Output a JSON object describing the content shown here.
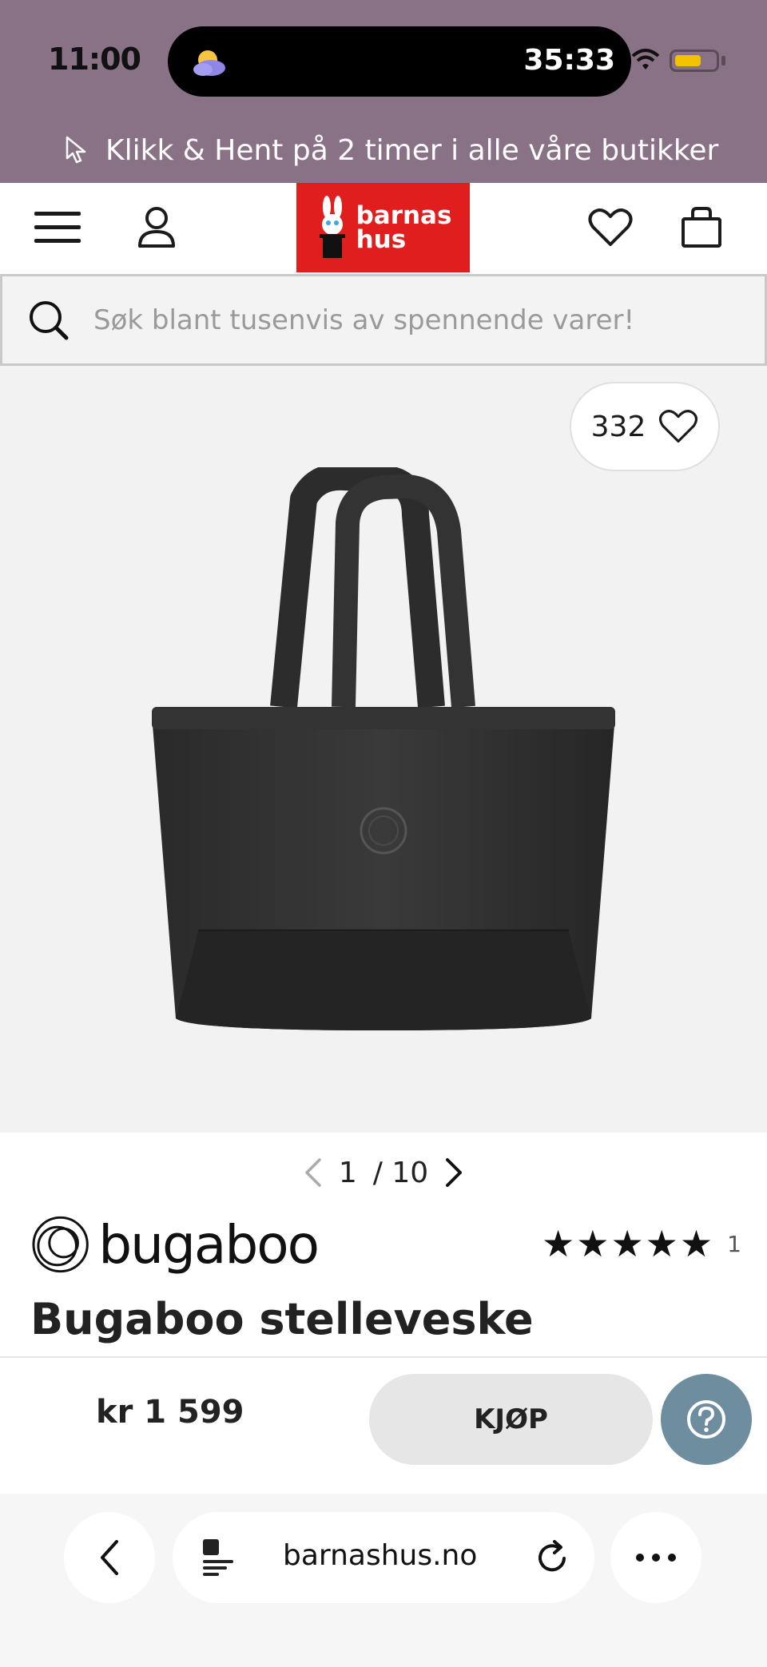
{
  "status_bar": {
    "time": "11:00",
    "timer": "35:33"
  },
  "promo": {
    "text": "Klikk & Hent på 2 timer i alle våre butikker"
  },
  "header": {
    "logo_line1": "barnas",
    "logo_line2": "hus"
  },
  "search": {
    "placeholder": "Søk blant tusenvis av spennende varer!"
  },
  "gallery": {
    "favorites_count": "332",
    "pager_current": "1",
    "pager_total": "/ 10"
  },
  "product": {
    "brand": "bugaboo",
    "stars": "★★★★★",
    "rating_count": "1",
    "title": "Bugaboo stelleveske",
    "price": "kr 1 599",
    "buy_label": "KJØP"
  },
  "browser": {
    "url": "barnashus.no"
  },
  "colors": {
    "promo_bg": "#8a7286",
    "logo_red": "#e01e1e",
    "help_blue": "#6e8ea0"
  }
}
